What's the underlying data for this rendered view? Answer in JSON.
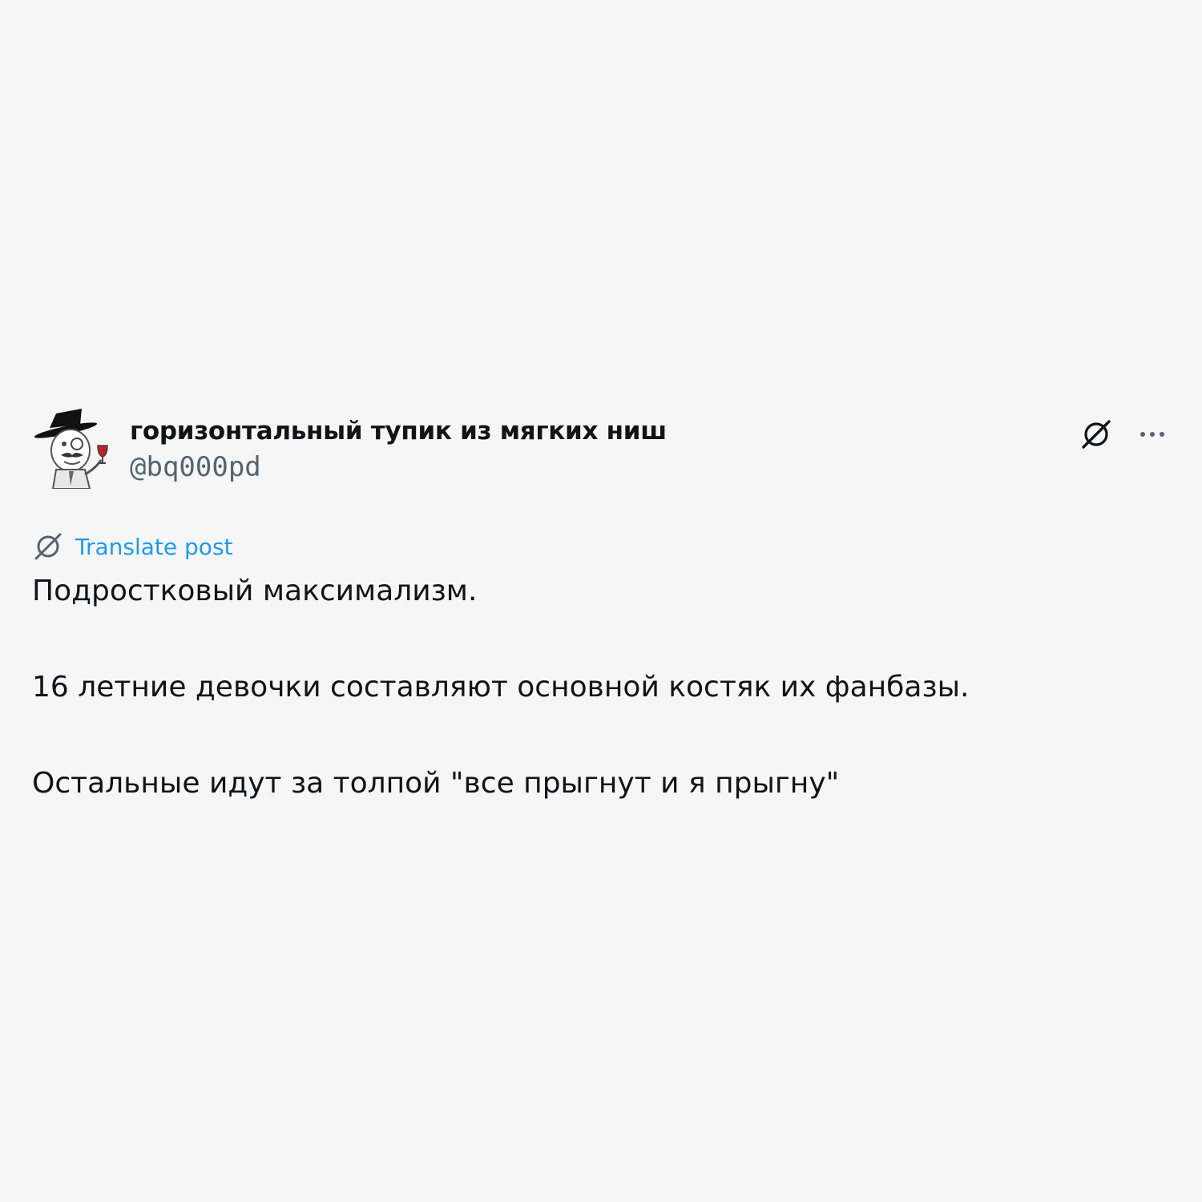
{
  "post": {
    "author": {
      "display_name": "горизонтальный тупик из мягких ниш",
      "handle": "@bq000pd",
      "avatar_icon": "gentleman-with-top-hat-and-wine-glass"
    },
    "actions": {
      "translate_icon": "globe-slash-icon",
      "more_icon": "more-horizontal-icon"
    },
    "translate_label": "Translate post",
    "paragraphs": [
      "Подростковый максимализм.",
      "16 летние девочки составляют основной костяк их фанбазы.",
      "Остальные идут за толпой \"все прыгнут и я прыгну\""
    ],
    "colors": {
      "background": "#f6f6f6",
      "text": "#0f1419",
      "secondary": "#536471",
      "link": "#1d9bf0"
    }
  }
}
